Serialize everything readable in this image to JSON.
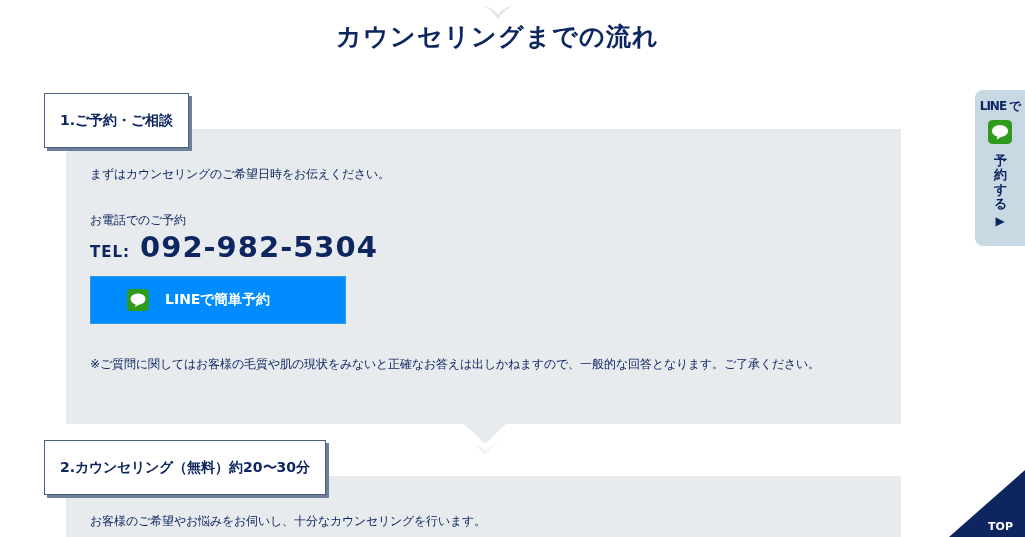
{
  "title": "カウンセリングまでの流れ",
  "steps": [
    {
      "heading": "1.ご予約・ご相談",
      "blocks": [
        {
          "kind": "text",
          "text": "まずはカウンセリングのご希望日時をお伝えください。"
        },
        {
          "kind": "label",
          "text": "お電話でのご予約"
        },
        {
          "kind": "phone",
          "prefix": "TEL:",
          "number": "092-982-5304"
        },
        {
          "kind": "line_button",
          "label": "LINEで簡単予約"
        },
        {
          "kind": "note",
          "text": "※ご質問に関してはお客様の毛質や肌の現状をみないと正確なお答えは出しかねますので、一般的な回答となります。ご了承ください。"
        }
      ]
    },
    {
      "heading": "2.カウンセリング（無料）約20〜30分",
      "blocks": [
        {
          "kind": "text",
          "text": "お客様のご希望やお悩みをお伺いし、十分なカウンセリングを行います。"
        }
      ]
    }
  ],
  "side_tab": {
    "prefix": "LINE で",
    "label": "予約する",
    "arrow": "▶"
  },
  "top_button": {
    "label": "TOP"
  }
}
